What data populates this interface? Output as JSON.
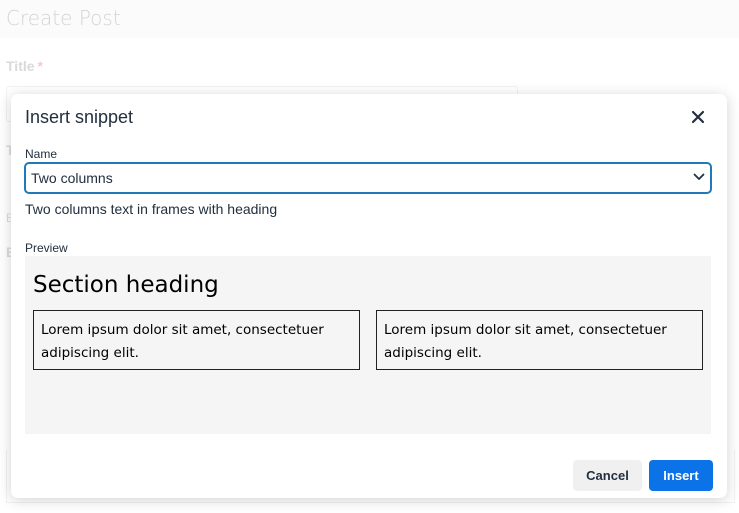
{
  "page": {
    "title": "Create Post",
    "title_field_label": "Title",
    "required_marker": "*",
    "ghost_labels": [
      "T",
      "E",
      "E"
    ]
  },
  "dialog": {
    "title": "Insert snippet",
    "close_icon": "close-icon",
    "name_label": "Name",
    "selected_snippet": "Two columns",
    "description": "Two columns text in frames with heading",
    "preview_label": "Preview",
    "preview": {
      "heading": "Section heading",
      "columns": [
        "Lorem ipsum dolor sit amet, consectetuer adipiscing elit.",
        "Lorem ipsum dolor sit amet, consectetuer adipiscing elit."
      ]
    },
    "cancel_label": "Cancel",
    "insert_label": "Insert"
  },
  "colors": {
    "primary": "#0b72e8",
    "focus_border": "#207ab7",
    "required": "#f0b8b8"
  }
}
